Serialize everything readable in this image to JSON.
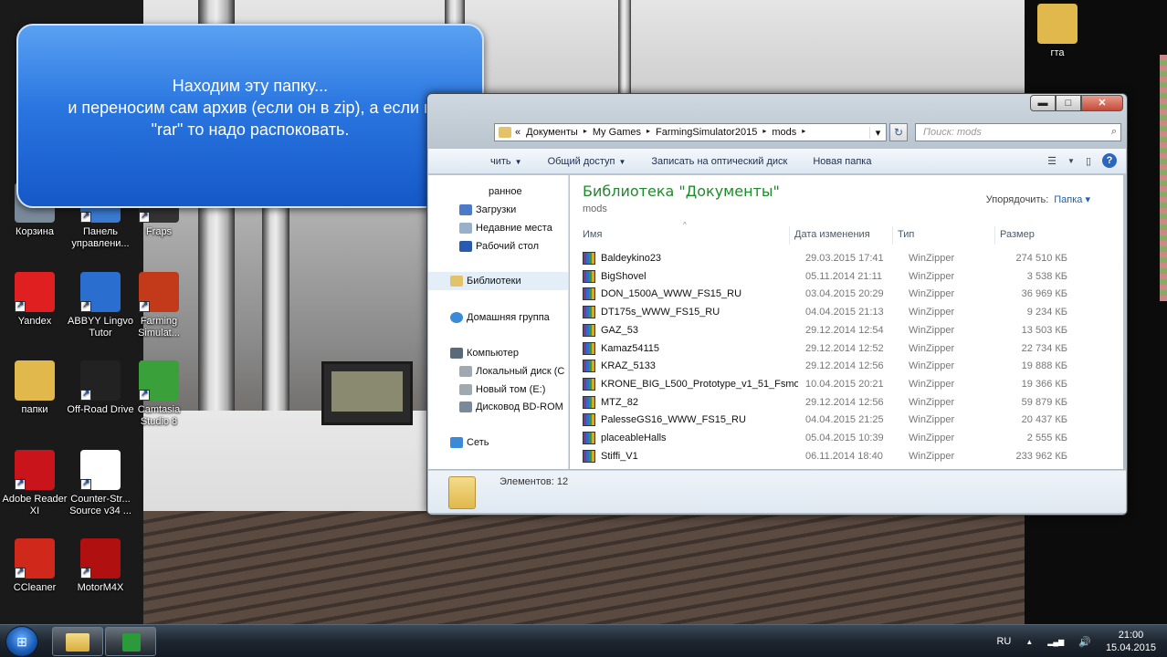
{
  "desktop": {
    "icons": [
      {
        "label": "Корзина",
        "icon": "recycle-bin-icon",
        "color": "#7a8a9a"
      },
      {
        "label": "Панель управлени...",
        "icon": "control-panel-icon",
        "color": "#3a7ad0"
      },
      {
        "label": "Fraps",
        "icon": "fraps-icon",
        "color": "#333333"
      },
      {
        "label": "Yandex",
        "icon": "yandex-icon",
        "color": "#e02020"
      },
      {
        "label": "ABBYY Lingvo Tutor",
        "icon": "abbyy-icon",
        "color": "#2a6fd0"
      },
      {
        "label": "Farming Simulat...",
        "icon": "farming-simulator-icon",
        "color": "#c23a1a"
      },
      {
        "label": "папки",
        "icon": "folder-icon",
        "color": "#e0b84c"
      },
      {
        "label": "Off-Road Drive",
        "icon": "offroad-drive-icon",
        "color": "#222222"
      },
      {
        "label": "Camtasia Studio 8",
        "icon": "camtasia-icon",
        "color": "#3aa03a"
      },
      {
        "label": "Adobe Reader XI",
        "icon": "adobe-reader-icon",
        "color": "#c8141a"
      },
      {
        "label": "Counter-Str... Source v34 ...",
        "icon": "file-icon",
        "color": "#ffffff"
      },
      {
        "label": "CCleaner",
        "icon": "ccleaner-icon",
        "color": "#d0281a"
      },
      {
        "label": "MotorM4X",
        "icon": "motorm4x-icon",
        "color": "#b01010"
      },
      {
        "label": "гта",
        "icon": "folder-icon",
        "color": "#e0b84c"
      }
    ]
  },
  "callout": {
    "line1": "Находим эту папку...",
    "line2": "и переносим сам архив (если он в zip), а если в",
    "line3": "\"rar\" то надо распоковать."
  },
  "explorer": {
    "window_buttons": {
      "minimize": "▬",
      "maximize": "□",
      "close": "✕"
    },
    "address": {
      "crumbs": [
        "«",
        "Документы",
        "▸",
        "My Games",
        "▸",
        "FarmingSimulator2015",
        "▸",
        "mods",
        "▸"
      ],
      "dropdown": "▾"
    },
    "refresh_glyph": "↻",
    "search_placeholder": "Поиск: mods",
    "search_glyph": "⌕",
    "toolbar": {
      "organize": "чить",
      "share": "Общий доступ",
      "burn": "Записать на оптический диск",
      "new_folder": "Новая папка",
      "view_glyph": "☰",
      "preview_glyph": "▯",
      "help_glyph": "?"
    },
    "nav": {
      "favorites_tail": "ранное",
      "downloads": "Загрузки",
      "recent": "Недавние места",
      "desktop": "Рабочий стол",
      "libraries": "Библиотеки",
      "homegroup": "Домашняя группа",
      "computer": "Компьютер",
      "local_disk": "Локальный диск (C",
      "new_volume": "Новый том (E:)",
      "bd_rom": "Дисковод BD-ROM",
      "network": "Сеть"
    },
    "library": {
      "title": "Библиотека \"Документы\"",
      "subtitle": "mods",
      "arrange_label": "Упорядочить:",
      "arrange_value": "Папка ▾"
    },
    "columns": {
      "name": "Имя",
      "date": "Дата изменения",
      "type": "Тип",
      "size": "Размер"
    },
    "files": [
      {
        "name": "Baldeykino23",
        "date": "29.03.2015 17:41",
        "type": "WinZipper",
        "size": "274 510 КБ"
      },
      {
        "name": "BigShovel",
        "date": "05.11.2014 21:11",
        "type": "WinZipper",
        "size": "3 538 КБ"
      },
      {
        "name": "DON_1500A_WWW_FS15_RU",
        "date": "03.04.2015 20:29",
        "type": "WinZipper",
        "size": "36 969 КБ"
      },
      {
        "name": "DT175s_WWW_FS15_RU",
        "date": "04.04.2015 21:13",
        "type": "WinZipper",
        "size": "9 234 КБ"
      },
      {
        "name": "GAZ_53",
        "date": "29.12.2014 12:54",
        "type": "WinZipper",
        "size": "13 503 КБ"
      },
      {
        "name": "Kamaz54115",
        "date": "29.12.2014 12:52",
        "type": "WinZipper",
        "size": "22 734 КБ"
      },
      {
        "name": "KRAZ_5133",
        "date": "29.12.2014 12:56",
        "type": "WinZipper",
        "size": "19 888 КБ"
      },
      {
        "name": "KRONE_BIG_L500_Prototype_v1_51_Fsmo...",
        "date": "10.04.2015 20:21",
        "type": "WinZipper",
        "size": "19 366 КБ"
      },
      {
        "name": "MTZ_82",
        "date": "29.12.2014 12:56",
        "type": "WinZipper",
        "size": "59 879 КБ"
      },
      {
        "name": "PalesseGS16_WWW_FS15_RU",
        "date": "04.04.2015 21:25",
        "type": "WinZipper",
        "size": "20 437 КБ"
      },
      {
        "name": "placeableHalls",
        "date": "05.04.2015 10:39",
        "type": "WinZipper",
        "size": "2 555 КБ"
      },
      {
        "name": "Stiffi_V1",
        "date": "06.11.2014 18:40",
        "type": "WinZipper",
        "size": "233 962 КБ"
      }
    ],
    "status": "Элементов: 12"
  },
  "taskbar": {
    "start_glyph": "⊞",
    "lang": "RU",
    "time": "21:00",
    "date": "15.04.2015",
    "tray_glyphs": {
      "up": "▲",
      "network": "▂▄▆",
      "volume": "🔊"
    }
  }
}
